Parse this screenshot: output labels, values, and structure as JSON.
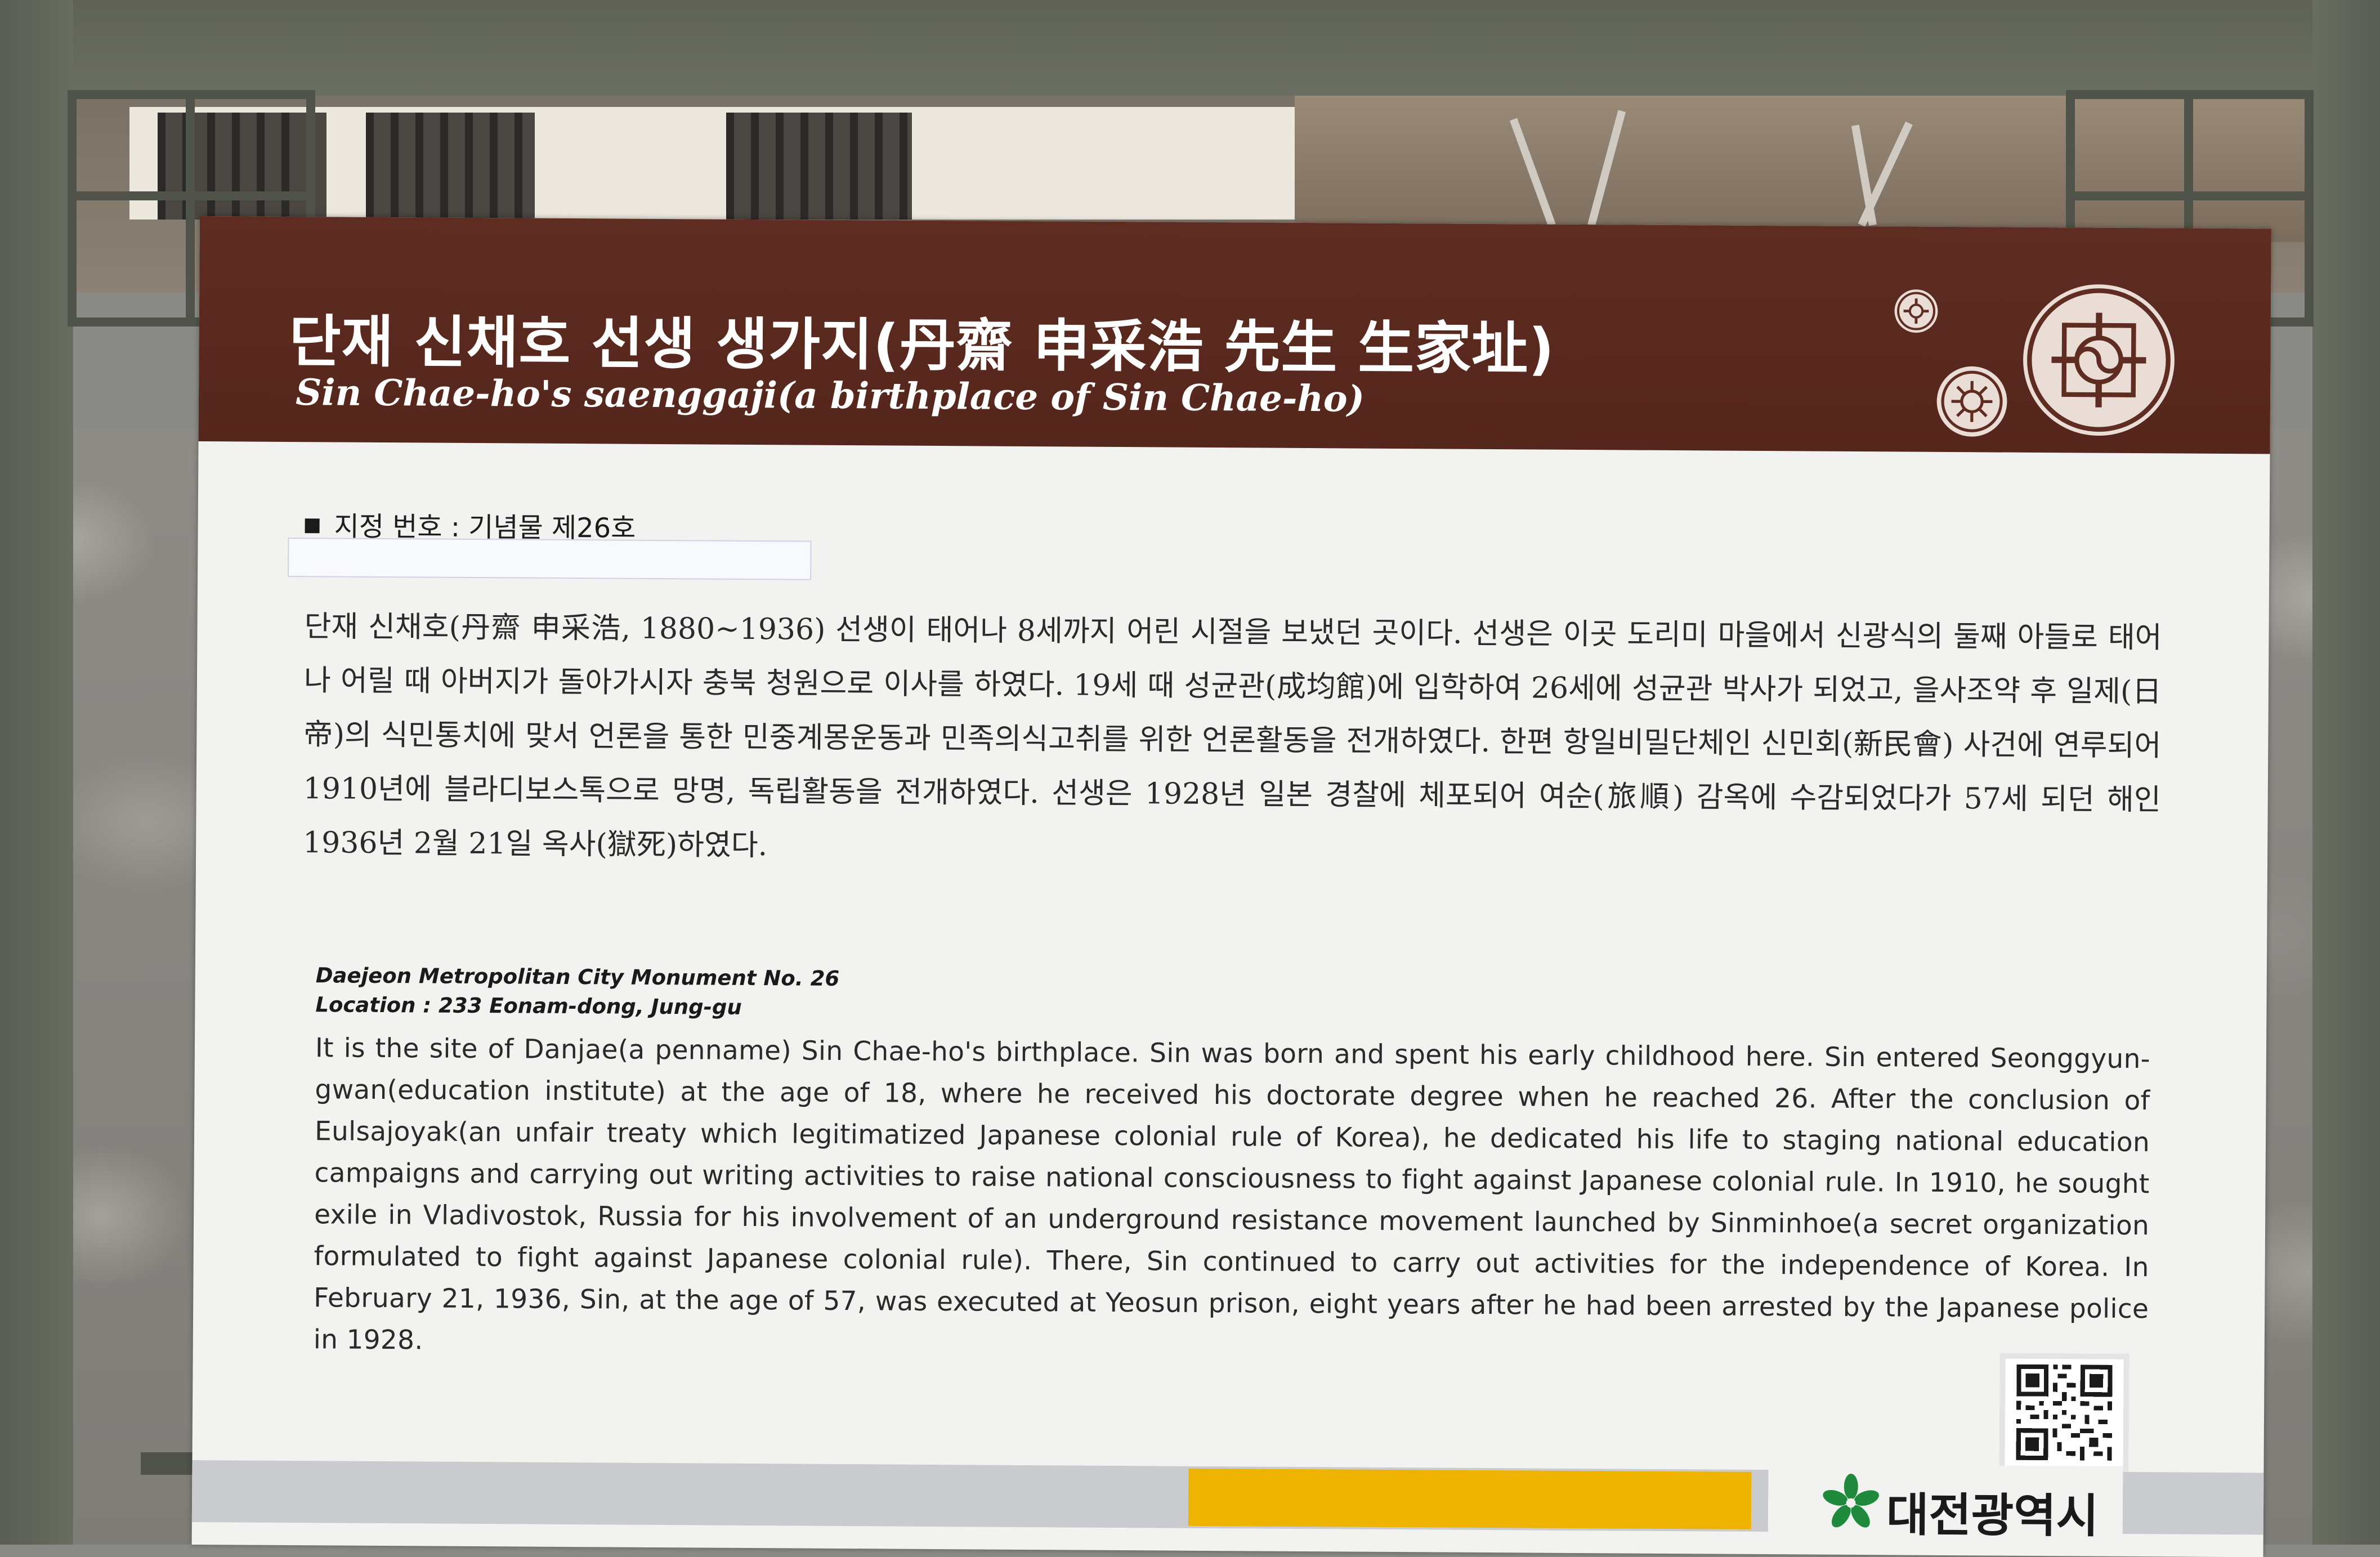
{
  "sign": {
    "title_ko": "단재 신채호 선생 생가지(丹齋 申采浩 先生 生家址)",
    "title_en": "Sin Chae-ho's saenggaji(a birthplace of Sin Chae-ho)",
    "designation_ko": "지정 번호 : 기념물 제26호",
    "body_ko": "단재 신채호(丹齋 申采浩, 1880~1936) 선생이 태어나 8세까지 어린 시절을 보냈던 곳이다. 선생은 이곳 도리미 마을에서 신광식의 둘째 아들로 태어나 어릴 때 아버지가 돌아가시자 충북 청원으로 이사를 하였다. 19세 때 성균관(成均館)에 입학하여 26세에 성균관 박사가 되었고, 을사조약 후 일제(日帝)의 식민통치에 맞서 언론을 통한 민중계몽운동과 민족의식고취를 위한 언론활동을 전개하였다. 한편 항일비밀단체인 신민회(新民會) 사건에 연루되어 1910년에 블라디보스톡으로 망명, 독립활동을 전개하였다. 선생은 1928년 일본 경찰에 체포되어 여순(旅順) 감옥에 수감되었다가 57세 되던 해인 1936년 2월 21일 옥사(獄死)하였다.",
    "monument_en": "Daejeon Metropolitan City Monument No. 26",
    "location_en": "Location : 233 Eonam-dong, Jung-gu",
    "body_en": "It is the site of Danjae(a penname) Sin Chae-ho's birthplace. Sin was born and spent his early childhood here. Sin entered Seonggyun-gwan(education institute) at the age of 18, where he received his doctorate degree when he reached 26. After the conclusion of Eulsajoyak(an unfair treaty which legitimatized Japanese colonial rule of Korea), he dedicated his life to staging national education campaigns and carrying out writing activities to raise national consciousness to fight against Japanese colonial rule. In 1910, he sought exile in Vladivostok, Russia for his involvement of an underground resistance movement launched by Sinminhoe(a secret organization formulated to fight against Japanese colonial rule). There, Sin continued to carry out activities for the independence of Korea. In February 21, 1936, Sin, at the age of 57, was executed at Yeosun prison, eight years after he had been arrested by the Japanese police in 1928.",
    "footer_org": "대전광역시"
  },
  "colors": {
    "header": "#5e2c21",
    "footer_accent": "#eeb300",
    "footer_strip": "#c9cbcf",
    "logo_green": "#1f8a3c"
  },
  "icons": {
    "emblem": "traditional-round-pattern-icon",
    "qr": "qr-code-icon",
    "logo": "daejeon-city-logo-icon"
  }
}
